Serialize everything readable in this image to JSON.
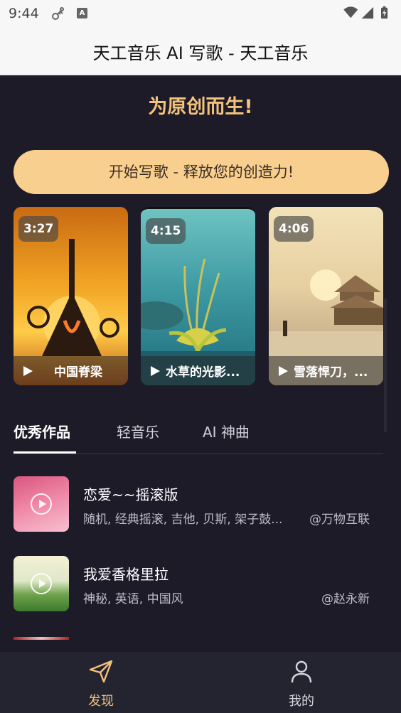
{
  "status_bar": {
    "time": "9:44",
    "icons": [
      "key-icon",
      "a-icon",
      "wifi-icon",
      "signal-icon",
      "battery-icon"
    ]
  },
  "title_bar": {
    "title": "天工音乐 AI 写歌 - 天工音乐"
  },
  "hero": {
    "slogan": "为原创而生!",
    "cta_label": "开始写歌 - 释放您的创造力!"
  },
  "featured": [
    {
      "duration": "3:27",
      "title": "中国脊梁"
    },
    {
      "duration": "4:15",
      "title": "水草的光影..."
    },
    {
      "duration": "4:06",
      "title": "雪落悍刀，..."
    }
  ],
  "tabs": [
    {
      "label": "优秀作品",
      "active": true
    },
    {
      "label": "轻音乐",
      "active": false
    },
    {
      "label": "AI 神曲",
      "active": false
    }
  ],
  "songs": [
    {
      "title": "恋爱~~摇滚版",
      "tags": "随机, 经典摇滚, 吉他, 贝斯, 架子鼓...",
      "author": "@万物互联"
    },
    {
      "title": "我爱香格里拉",
      "tags": "神秘, 英语, 中国风",
      "author": "@赵永新"
    }
  ],
  "bottom_nav": [
    {
      "label": "发现",
      "icon": "send-icon",
      "active": true
    },
    {
      "label": "我的",
      "icon": "user-icon",
      "active": false
    }
  ],
  "colors": {
    "accent": "#f5c27a",
    "cta_bg": "#f9cf8f",
    "background": "#1e1b29",
    "nav_bg": "#232430"
  }
}
